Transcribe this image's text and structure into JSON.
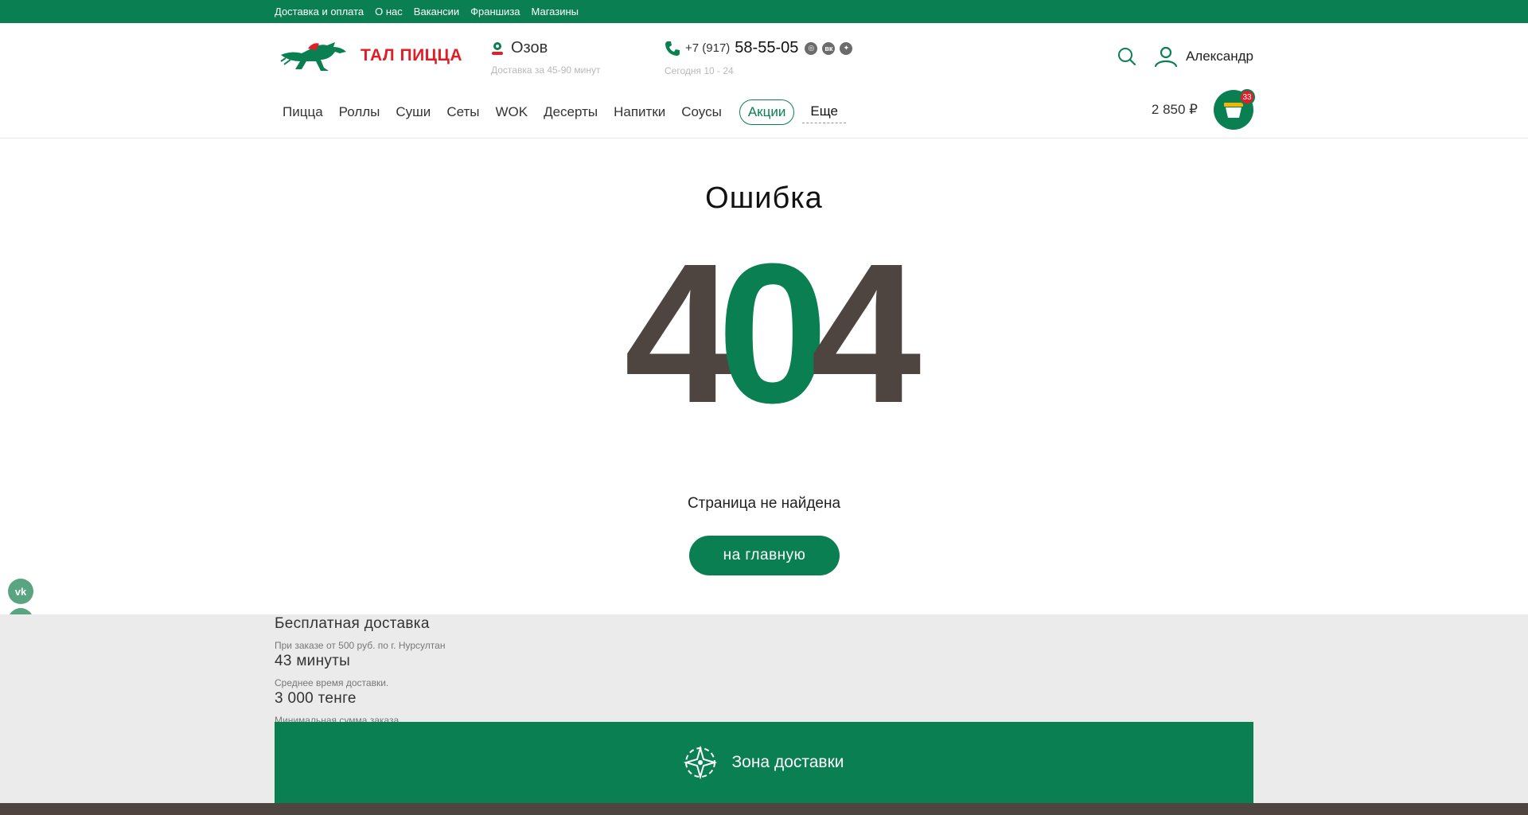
{
  "topbar": {
    "links": [
      "Доставка и оплата",
      "О нас",
      "Вакансии",
      "Франшиза",
      "Магазины"
    ]
  },
  "header": {
    "brand": "ТАЛ ПИЦЦА",
    "city": "Озов",
    "delivery_time": "Доставка за 45-90 минут",
    "phone_code": "+7 (917)",
    "phone_number": "58-55-05",
    "hours": "Сегодня 10 - 24",
    "user_name": "Александр"
  },
  "menu": {
    "items": [
      "Пицца",
      "Роллы",
      "Суши",
      "Сеты",
      "WOK",
      "Десерты",
      "Напитки",
      "Соусы"
    ],
    "promo": "Акции",
    "more": "Еще"
  },
  "cart": {
    "sum": "2 850 ₽",
    "count": "33"
  },
  "error": {
    "title": "Ошибка",
    "code_digits": [
      "4",
      "0",
      "4"
    ],
    "message": "Страница не найдена",
    "home_button": "на главную"
  },
  "info": {
    "free_delivery_title": "Бесплатная доставка",
    "free_delivery_sub": "При заказе от 500 руб. по г. Нурсултан",
    "avg_time_title": "43 минуты",
    "avg_time_sub": "Среднее время доставки.",
    "min_sum_title": "3 000 тенге",
    "min_sum_sub": "Минимальная сумма заказа"
  },
  "zone": {
    "label": "Зона доставки"
  },
  "colors": {
    "brand_green": "#0a8052",
    "brand_red": "#e11d27",
    "dark_brown": "#4e4540"
  }
}
